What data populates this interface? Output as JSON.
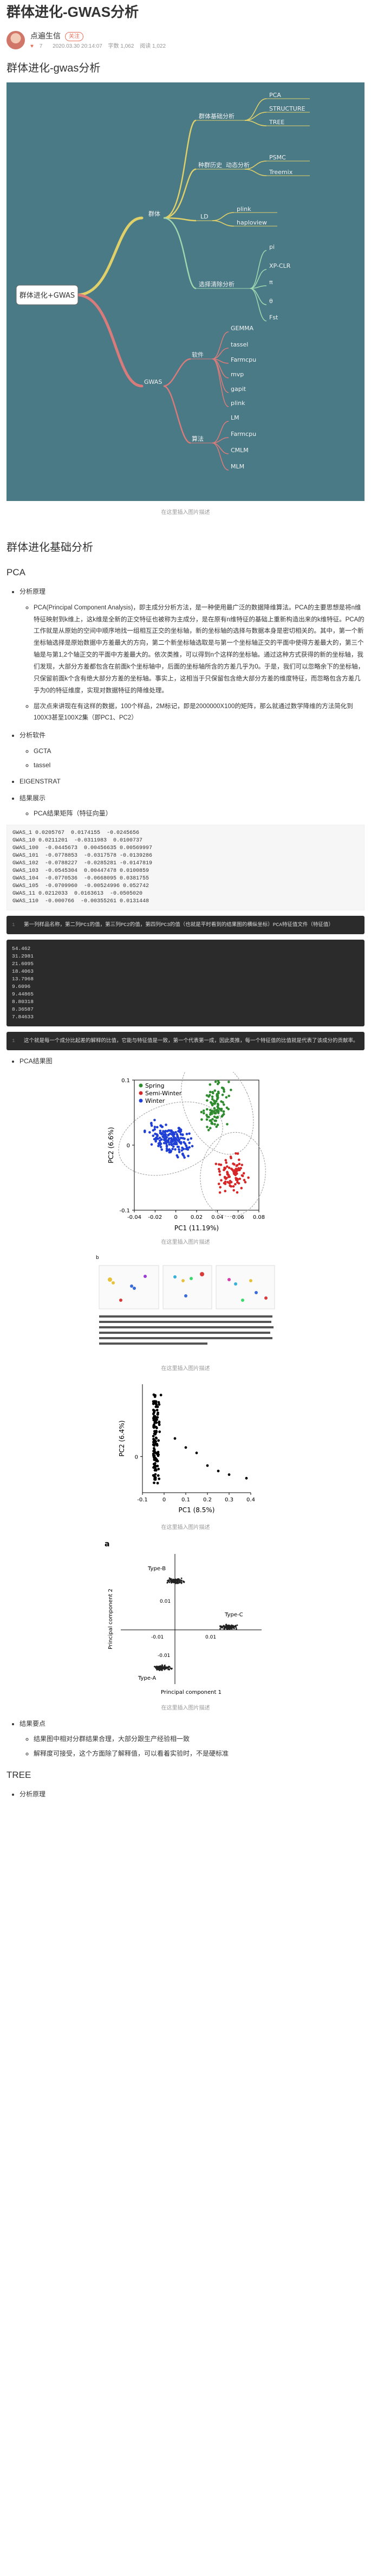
{
  "article": {
    "title": "群体进化-GWAS分析",
    "author": "点遍生信",
    "follow_label": "关注",
    "stats": {
      "likes": "7",
      "date": "2020.03.30 20:14:07",
      "words": "字数 1,062",
      "reads": "阅读 1,022"
    }
  },
  "sections": {
    "s1_title": "群体进化-gwas分析",
    "s2_title": "群体进化基础分析",
    "pca_title": "PCA",
    "tree_title": "TREE"
  },
  "mindmap": {
    "root": "群体进化+GWAS",
    "branch1": "群体",
    "branch1_children": {
      "basic": "群体基础分析",
      "basic_items": [
        "PCA",
        "STRUCTURE",
        "TREE"
      ],
      "history": "种群历史",
      "dynamic": "动态分析",
      "history_items": [
        "PSMC",
        "Treemix"
      ],
      "ld": "LD",
      "ld_items": [
        "plink",
        "haploview"
      ],
      "selection": "选择清除分析",
      "selection_items": [
        "pi",
        "XP-CLR",
        "π",
        "θ",
        "Fst"
      ]
    },
    "branch2": "GWAS",
    "branch2_children": {
      "software": "软件",
      "software_items": [
        "GEMMA",
        "tassel",
        "Farmcpu",
        "mvp",
        "gapit",
        "plink"
      ],
      "algorithm": "算法",
      "algorithm_items": [
        "LM",
        "Farmcpu",
        "CMLM",
        "MLM"
      ]
    }
  },
  "captions": {
    "image_caption": "在这里插入图片描述"
  },
  "pca": {
    "principle_label": "分析原理",
    "principle_text": "PCA(Principal Component Analysis)，即主成分分析方法，是一种使用最广泛的数据降维算法。PCA的主要思想是将n维特征映射到k维上，这k维是全新的正交特征也被称为主成分，是在原有n维特征的基础上重新构造出来的k维特征。PCA的工作就是从原始的空间中顺序地找一组相互正交的坐标轴，新的坐标轴的选择与数据本身是密切相关的。其中，第一个新坐标轴选择是原始数据中方差最大的方向，第二个新坐标轴选取是与第一个坐标轴正交的平面中使得方差最大的，第三个轴是与第1,2个轴正交的平面中方差最大的。依次类推，可以得到n个这样的坐标轴。通过这种方式获得的新的坐标轴，我们发现，大部分方差都包含在前面k个坐标轴中，后面的坐标轴所含的方差几乎为0。于是，我们可以忽略余下的坐标轴，只保留前面k个含有绝大部分方差的坐标轴。事实上，这相当于只保留包含绝大部分方差的维度特征，而忽略包含方差几乎为0的特征维度，实现对数据特征的降维处理。",
    "data_text": "层次点来讲现在有这样的数据，100个样品，2M标记，即是2000000X100的矩阵，那么就通过数学降维的方法简化到100X3甚至100X2集（即PC1、PC2）",
    "software_label": "分析软件",
    "software_items": [
      "GCTA",
      "tassel"
    ],
    "eigenstrat_label": "EIGENSTRAT",
    "result_label": "结果展示",
    "result_sub": "PCA结果矩阵（特征向量）",
    "code1": "GWAS_1 0.0205767  0.0174155  -0.0245656\nGWAS_10 0.0211201  -0.0311983  0.0100737\nGWAS_100  -0.0445673  0.00456635 0.00569997\nGWAS_101  -0.0778853  -0.0317578 -0.0139286\nGWAS_102  -0.0788227  -0.0285281 -0.0147819\nGWAS_103  -0.0545304  0.00447478 0.0100859\nGWAS_104  -0.0770536  -0.0668095 0.0381755\nGWAS_105  -0.0709960  -0.00524996 0.052742\nGWAS_11 0.0212033  0.0163613  -0.0505020\nGWAS_110  -0.000766  -0.00355261 0.0131448",
    "note1": "第一列样品名称，第二列PC1的值，第三列PC2的值，第四列PC3的值（也就是平时看到的结果图的横纵坐标）PCA特征值文件（特征值）",
    "code2": "54.462\n31.2981\n21.6095\n18.4063\n13.7968\n9.6096\n9.44865\n8.80318\n8.36587\n7.84633",
    "note2": "这个就是每一个成分比起差的解释的比值，它能与特征值是一致，第一个代表第一成，因此类推，每一个特征值的比值就是代表了该成分的贡献率。",
    "plot_label": "PCA结果图"
  },
  "charts": {
    "caption1": "在这里插入图片描述",
    "caption2": "在这里插入图片描述",
    "caption3": "在这里插入图片描述",
    "caption4": "在这里插入图片描述"
  },
  "chart_data": [
    {
      "type": "scatter",
      "title": "",
      "xlabel": "PC1 (11.19%)",
      "ylabel": "PC2 (6.6%)",
      "xlim": [
        -0.04,
        0.08
      ],
      "ylim": [
        -0.1,
        0.1
      ],
      "xticks": [
        "-0.04",
        "-0.02",
        "0",
        "0.02",
        "0.04",
        "0.06",
        "0.08"
      ],
      "yticks": [
        "-0.1",
        "0",
        "0.1"
      ],
      "legend_position": "top-left",
      "series": [
        {
          "name": "Spring",
          "color": "#2e8b2e"
        },
        {
          "name": "Semi-Winter",
          "color": "#d62728"
        },
        {
          "name": "Winter",
          "color": "#1f3fd6"
        }
      ]
    },
    {
      "type": "scatter",
      "title": "",
      "xlabel": "PC1 (8.5%)",
      "ylabel": "PC2 (6.4%)",
      "xlim": [
        -0.1,
        0.4
      ],
      "ylim": [
        -0.2,
        0.4
      ],
      "xticks": [
        "-0.1",
        "0",
        "0.1",
        "0.2",
        "0.3",
        "0.4"
      ],
      "yticks": [
        "0"
      ],
      "series": [
        {
          "color": "#000000"
        }
      ]
    },
    {
      "type": "scatter",
      "title": "a",
      "xlabel": "Principal component 1",
      "ylabel": "Principal component 2",
      "xlim": [
        -0.01,
        0.05
      ],
      "ylim": [
        -0.06,
        0.04
      ],
      "xticks": [
        "-0.01",
        "0.01"
      ],
      "yticks": [
        "0.01",
        "-0.01"
      ],
      "labels": [
        "Type-B",
        "Type-C",
        "Type-A"
      ],
      "series": [
        {
          "color": "#222222"
        }
      ]
    }
  ],
  "results": {
    "key_label": "结果要点",
    "key_items": [
      "结果图中相对分群结果合理，大部分跟生产经验相一致",
      "解释度可接受，这个方面除了解释值，可以看着实验时，不是硬标准"
    ]
  },
  "tree": {
    "principle_label": "分析原理"
  }
}
